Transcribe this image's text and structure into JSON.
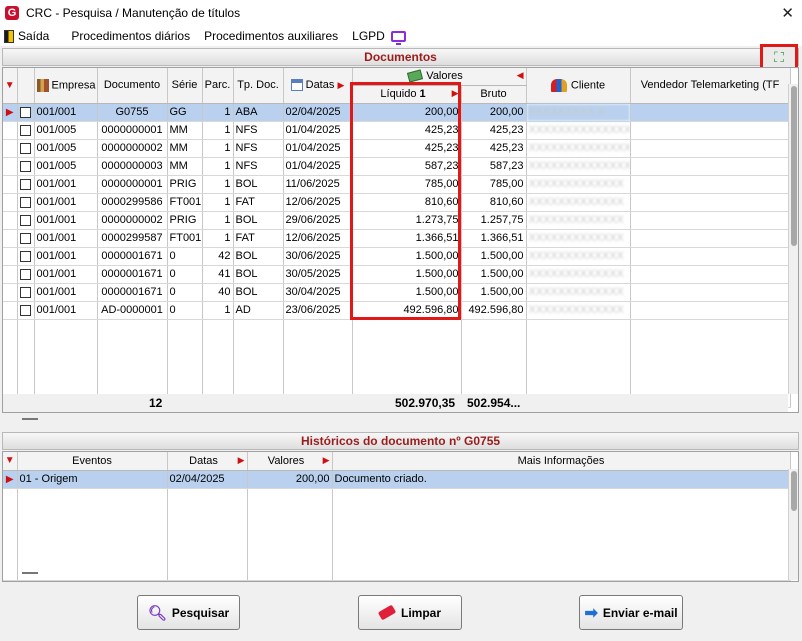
{
  "window": {
    "title": "CRC - Pesquisa / Manutenção de títulos",
    "logo": "G",
    "close_glyph": "✕"
  },
  "menu": [
    {
      "label": "Saída",
      "icon": "exit-icon"
    },
    {
      "label": "Procedimentos diários"
    },
    {
      "label": "Procedimentos auxiliares"
    },
    {
      "label": "LGPD",
      "icon": "monitor-icon"
    }
  ],
  "documents": {
    "header": "Documentos",
    "columns": {
      "empresa": "Empresa",
      "documento": "Documento",
      "serie": "Série",
      "parc": "Parc.",
      "tp_doc": "Tp. Doc.",
      "datas": "Datas",
      "valores": "Valores",
      "liquido": "Líquido",
      "liquido_sort": "1",
      "bruto": "Bruto",
      "cliente": "Cliente",
      "vendedor": "Vendedor Telemarketing (TF"
    },
    "rows": [
      {
        "empresa": "001/001",
        "documento": "G0755",
        "serie": "GG",
        "parc": "1",
        "tp": "ABA",
        "data": "02/04/2025",
        "liquido": "200,00",
        "bruto": "200,00",
        "cliente": "XXXXXXXXX X",
        "selected": true
      },
      {
        "empresa": "001/005",
        "documento": "0000000001",
        "serie": "MM",
        "parc": "1",
        "tp": "NFS",
        "data": "01/04/2025",
        "liquido": "425,23",
        "bruto": "425,23",
        "cliente": "XXXXXXXXXXXXXXX"
      },
      {
        "empresa": "001/005",
        "documento": "0000000002",
        "serie": "MM",
        "parc": "1",
        "tp": "NFS",
        "data": "01/04/2025",
        "liquido": "425,23",
        "bruto": "425,23",
        "cliente": "XXXXXXXXXXXXXXX"
      },
      {
        "empresa": "001/005",
        "documento": "0000000003",
        "serie": "MM",
        "parc": "1",
        "tp": "NFS",
        "data": "01/04/2025",
        "liquido": "587,23",
        "bruto": "587,23",
        "cliente": "XXXXXXXXXXXXXXX"
      },
      {
        "empresa": "001/001",
        "documento": "0000000001",
        "serie": "PRIG",
        "parc": "1",
        "tp": "BOL",
        "data": "11/06/2025",
        "liquido": "785,00",
        "bruto": "785,00",
        "cliente": "XXXXXXXXXXXXX"
      },
      {
        "empresa": "001/001",
        "documento": "0000299586",
        "serie": "FT001",
        "parc": "1",
        "tp": "FAT",
        "data": "12/06/2025",
        "liquido": "810,60",
        "bruto": "810,60",
        "cliente": "XXXXXXXXXXXXX"
      },
      {
        "empresa": "001/001",
        "documento": "0000000002",
        "serie": "PRIG",
        "parc": "1",
        "tp": "BOL",
        "data": "29/06/2025",
        "liquido": "1.273,75",
        "bruto": "1.257,75",
        "cliente": "XXXXXXXXXXXXX"
      },
      {
        "empresa": "001/001",
        "documento": "0000299587",
        "serie": "FT001",
        "parc": "1",
        "tp": "FAT",
        "data": "12/06/2025",
        "liquido": "1.366,51",
        "bruto": "1.366,51",
        "cliente": "XXXXXXXXXXXXX"
      },
      {
        "empresa": "001/001",
        "documento": "0000001671",
        "serie": "0",
        "parc": "42",
        "tp": "BOL",
        "data": "30/06/2025",
        "liquido": "1.500,00",
        "bruto": "1.500,00",
        "cliente": "XXXXXXXXXXXXX"
      },
      {
        "empresa": "001/001",
        "documento": "0000001671",
        "serie": "0",
        "parc": "41",
        "tp": "BOL",
        "data": "30/05/2025",
        "liquido": "1.500,00",
        "bruto": "1.500,00",
        "cliente": "XXXXXXXXXXXXX"
      },
      {
        "empresa": "001/001",
        "documento": "0000001671",
        "serie": "0",
        "parc": "40",
        "tp": "BOL",
        "data": "30/04/2025",
        "liquido": "1.500,00",
        "bruto": "1.500,00",
        "cliente": "XXXXXXXXXXXXX"
      },
      {
        "empresa": "001/001",
        "documento": "AD-0000001",
        "serie": "0",
        "parc": "1",
        "tp": "AD",
        "data": "23/06/2025",
        "liquido": "492.596,80",
        "bruto": "492.596,80",
        "cliente": "XXXXXXXXXXXXX"
      }
    ],
    "totals": {
      "count": "12",
      "liquido": "502.970,35",
      "bruto": "502.954..."
    }
  },
  "history": {
    "header": "Históricos do documento nº G0755",
    "columns": {
      "eventos": "Eventos",
      "datas": "Datas",
      "valores": "Valores",
      "mais": "Mais Informações"
    },
    "rows": [
      {
        "evento": "01 - Origem",
        "data": "02/04/2025",
        "valor": "200,00",
        "info": "Documento criado."
      }
    ]
  },
  "buttons": {
    "pesquisar": "Pesquisar",
    "limpar": "Limpar",
    "enviar": "Enviar e-mail"
  },
  "colors": {
    "accent_red": "#e01818",
    "section_title": "#9b1c1c",
    "selection": "#b9d1ef"
  }
}
